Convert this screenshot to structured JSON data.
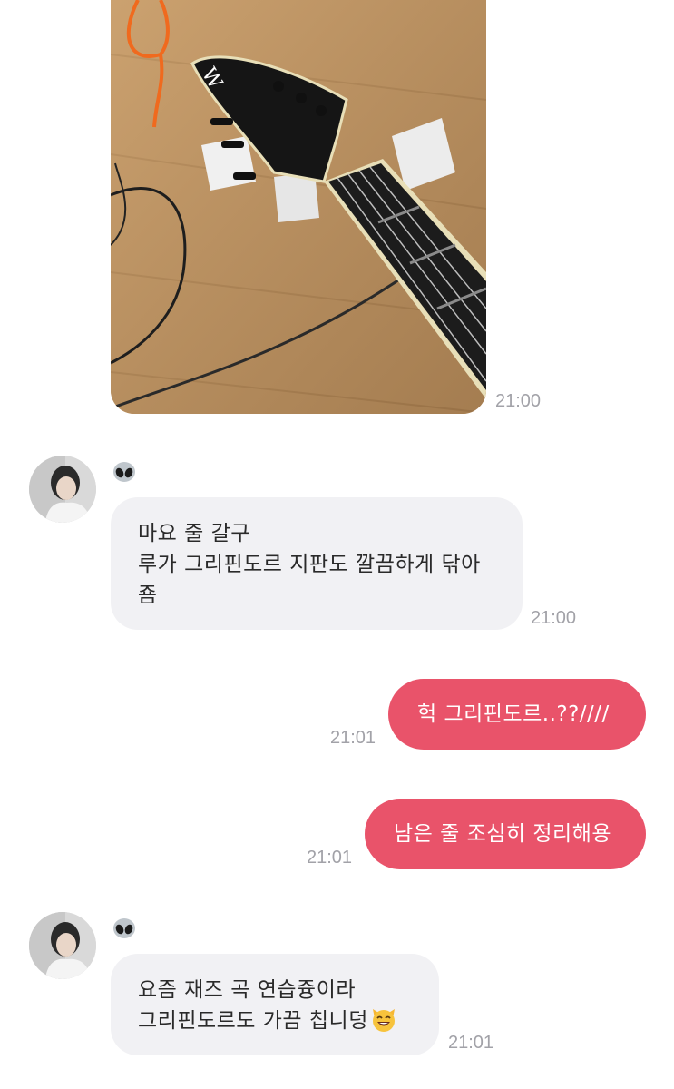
{
  "messages": [
    {
      "id": "photo",
      "type": "image",
      "alt": "guitar headstock photo",
      "time": "21:00"
    },
    {
      "id": "m1",
      "type": "incoming",
      "avatar_badge": "alien-emoji",
      "lines": [
        "마요 줄 갈구",
        "루가 그리핀도르 지판도 깔끔하게 닦아",
        "죰"
      ],
      "time": "21:00"
    },
    {
      "id": "m2",
      "type": "outgoing",
      "text": "헉 그리핀도르..??////",
      "time": "21:01"
    },
    {
      "id": "m3",
      "type": "outgoing",
      "text": "남은 줄 조심히 정리해용",
      "time": "21:01"
    },
    {
      "id": "m4",
      "type": "incoming",
      "avatar_badge": "alien-emoji",
      "lines": [
        "요즘 재즈 곡 연습즁이라",
        "그리핀도르도 가끔 칩니덩"
      ],
      "trailing_emoji": "smiling-cat-emoji",
      "time": "21:01"
    }
  ],
  "colors": {
    "outgoing_bubble": "#e9536a",
    "incoming_bubble": "#f1f1f4",
    "timestamp": "#a2a2a8"
  }
}
